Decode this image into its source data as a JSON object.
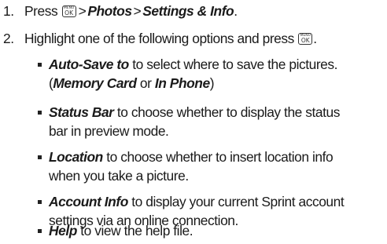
{
  "steps": [
    {
      "number": "1.",
      "before": "Press",
      "key_top": "MENU",
      "key_bottom": "OK",
      "gt1": ">",
      "path1": "Photos",
      "gt2": ">",
      "path2": "Settings & Info",
      "end": "."
    },
    {
      "number": "2.",
      "text": "Highlight one of the following options and press",
      "key_top": "MENU",
      "key_bottom": "OK",
      "end": "."
    }
  ],
  "bullets": [
    {
      "term": "Auto-Save to",
      "line1_rest": " to select where to save the pictures.",
      "line2_open": "(",
      "opt1": "Memory Card",
      "or": " or ",
      "opt2": "In Phone",
      "line2_close": ")"
    },
    {
      "term": "Status Bar",
      "line1_rest": " to choose whether to display the status",
      "line2": "bar in preview mode."
    },
    {
      "term": "Location",
      "line1_rest": " to choose whether to insert location info",
      "line2": "when you take a picture."
    },
    {
      "term": "Account Info",
      "line1_rest": " to display your current Sprint account",
      "line2": "settings via an online connection."
    },
    {
      "term": "Help",
      "line1_rest": " to view the help file."
    }
  ]
}
